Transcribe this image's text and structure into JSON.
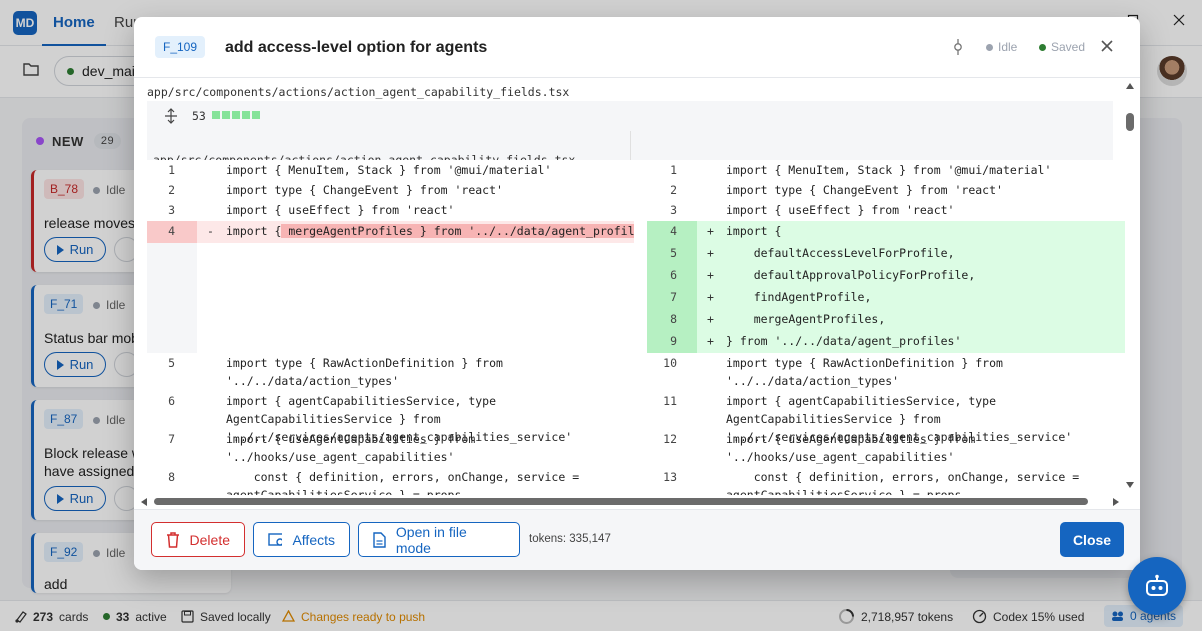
{
  "app": {
    "logo": "MD",
    "nav": [
      {
        "label": "Home"
      },
      {
        "label": "Run"
      }
    ],
    "branch": "dev_main"
  },
  "board": {
    "column": {
      "name": "NEW",
      "count": "29"
    },
    "cards": [
      {
        "id": "B_78",
        "status": "Idle",
        "title": "release moves",
        "run_label": "Run"
      },
      {
        "id": "F_71",
        "status": "Idle",
        "title": "Status bar mob",
        "run_label": "Run"
      },
      {
        "id": "F_87",
        "status": "Idle",
        "title": "Block release w",
        "title2": "have assigned",
        "run_label": "Run"
      },
      {
        "id": "F_92",
        "status": "Idle",
        "title": "add"
      }
    ]
  },
  "statusbar": {
    "cards_count": "273",
    "cards_label": "cards",
    "active_count": "33",
    "active_label": "active",
    "saved": "Saved locally",
    "push": "Changes ready to push",
    "tokens": "2,718,957 tokens",
    "codex": "Codex 15% used",
    "agents": "0 agents"
  },
  "dialog": {
    "id": "F_109",
    "title": "add access-level option for agents",
    "status": "Idle",
    "saved": "Saved",
    "file_path": "app/src/components/actions/action_agent_capability_fields.tsx",
    "change_count": "53",
    "diff_rows": [
      {
        "lnL": "1",
        "txL": "import { MenuItem, Stack } from '@mui/material'",
        "lnR": "1",
        "txR": "import { MenuItem, Stack } from '@mui/material'"
      },
      {
        "lnL": "2",
        "txL": "import type { ChangeEvent } from 'react'",
        "lnR": "2",
        "txR": "import type { ChangeEvent } from 'react'"
      },
      {
        "lnL": "3",
        "txL": "import { useEffect } from 'react'",
        "lnR": "3",
        "txR": "import { useEffect } from 'react'"
      },
      {
        "lnL": "4",
        "sgL": "-",
        "txL_pre": "import {",
        "txL_hl": " mergeAgentProfiles } from '../../data/agent_profiles'",
        "lnR": "4",
        "sgR": "+",
        "txR": "import {"
      },
      {
        "lnR": "5",
        "sgR": "+",
        "txR": "    defaultAccessLevelForProfile,"
      },
      {
        "lnR": "6",
        "sgR": "+",
        "txR": "    defaultApprovalPolicyForProfile,"
      },
      {
        "lnR": "7",
        "sgR": "+",
        "txR": "    findAgentProfile,"
      },
      {
        "lnR": "8",
        "sgR": "+",
        "txR": "    mergeAgentProfiles,"
      },
      {
        "lnR": "9",
        "sgR": "+",
        "txR": "} from '../../data/agent_profiles'"
      },
      {
        "lnL": "5",
        "txL": "import type { RawActionDefinition } from '../../data/action_types'",
        "lnR": "10",
        "txR": "import type { RawActionDefinition } from '../../data/action_types'"
      },
      {
        "lnL": "6",
        "txL": "import { agentCapabilitiesService, type AgentCapabilitiesService } from '../../services/agents/agent_capabilities_service'",
        "lnR": "11",
        "txR": "import { agentCapabilitiesService, type AgentCapabilitiesService } from '../../services/agents/agent_capabilities_service'"
      },
      {
        "lnL": "7",
        "txL": "import { useAgentCapabilities } from '../hooks/use_agent_capabilities'",
        "lnR": "12",
        "txR": "import { useAgentCapabilities } from '../hooks/use_agent_capabilities'"
      },
      {
        "lnL": "8",
        "txL": "    const { definition, errors, onChange, service = agentCapabilitiesService } = props",
        "lnR": "13",
        "txR": "    const { definition, errors, onChange, service = agentCapabilitiesService } = props"
      }
    ],
    "footer": {
      "delete": "Delete",
      "affects": "Affects",
      "open_file": "Open in file mode",
      "tokens": "tokens: 335,147",
      "close": "Close"
    }
  },
  "colors": {
    "accent": "#1565c0",
    "danger": "#d32f2f",
    "added": "#dcfce4",
    "removed": "#fde8e8"
  }
}
